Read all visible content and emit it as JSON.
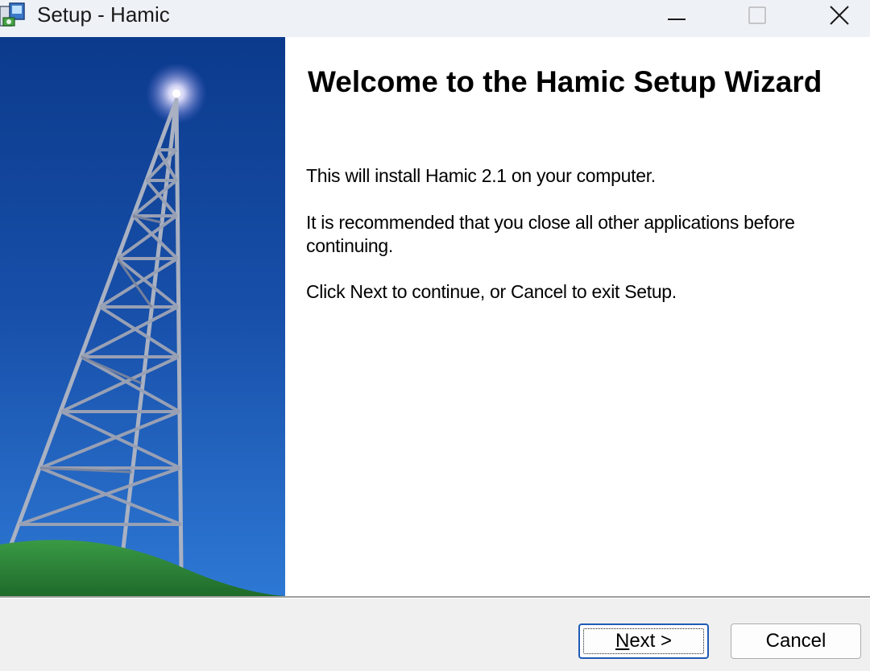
{
  "window": {
    "title": "Setup - Hamic",
    "controls": {
      "minimize": "minimize-icon",
      "maximize": "maximize-icon",
      "close": "close-icon"
    }
  },
  "banner": {
    "image": "radio-tower-illustration",
    "colors": {
      "sky_top": "#0b3a8c",
      "sky_bottom": "#2a74d2",
      "hill": "#2e8a3a",
      "tower": "#9aa3b5"
    }
  },
  "main": {
    "heading": "Welcome to the Hamic Setup Wizard",
    "paragraphs": [
      "This will install Hamic 2.1 on your computer.",
      "It is recommended that you close all other applications before continuing.",
      "Click Next to continue, or Cancel to exit Setup."
    ]
  },
  "footer": {
    "next_label": "Next >",
    "cancel_label": "Cancel"
  }
}
